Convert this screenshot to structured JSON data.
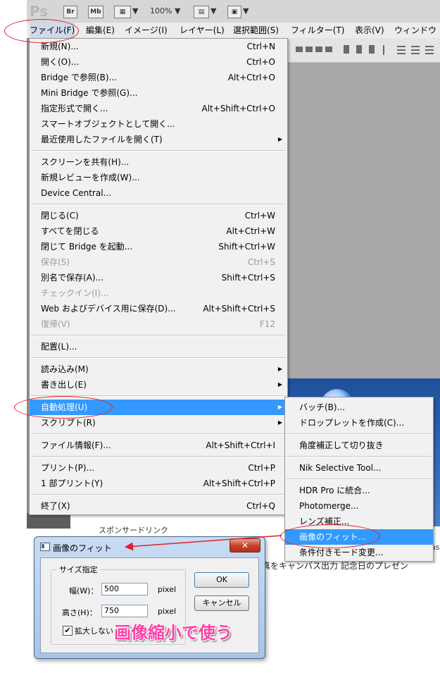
{
  "app": {
    "logo": "Ps",
    "toolbar": {
      "br": "Br",
      "mb": "Mb",
      "zoom": "100%"
    },
    "menubar": [
      "ファイル(F)",
      "編集(E)",
      "イメージ(I)",
      "レイヤー(L)",
      "選択範囲(S)",
      "フィルター(T)",
      "表示(V)",
      "ウィンドウ"
    ]
  },
  "file_menu": {
    "items": [
      {
        "label": "新規(N)...",
        "shortcut": "Ctrl+N"
      },
      {
        "label": "開く(O)...",
        "shortcut": "Ctrl+O"
      },
      {
        "label": "Bridge で参照(B)...",
        "shortcut": "Alt+Ctrl+O"
      },
      {
        "label": "Mini Bridge で参照(G)...",
        "shortcut": ""
      },
      {
        "label": "指定形式で開く...",
        "shortcut": "Alt+Shift+Ctrl+O"
      },
      {
        "label": "スマートオブジェクトとして開く...",
        "shortcut": ""
      },
      {
        "label": "最近使用したファイルを開く(T)",
        "shortcut": "",
        "submenu": true
      },
      {
        "label": "スクリーンを共有(H)...",
        "shortcut": ""
      },
      {
        "label": "新規レビューを作成(W)...",
        "shortcut": ""
      },
      {
        "label": "Device Central...",
        "shortcut": ""
      },
      {
        "label": "閉じる(C)",
        "shortcut": "Ctrl+W"
      },
      {
        "label": "すべてを閉じる",
        "shortcut": "Alt+Ctrl+W"
      },
      {
        "label": "閉じて Bridge を起動...",
        "shortcut": "Shift+Ctrl+W"
      },
      {
        "label": "保存(S)",
        "shortcut": "Ctrl+S",
        "disabled": true
      },
      {
        "label": "別名で保存(A)...",
        "shortcut": "Shift+Ctrl+S"
      },
      {
        "label": "チェックイン(I)...",
        "shortcut": "",
        "disabled": true
      },
      {
        "label": "Web およびデバイス用に保存(D)...",
        "shortcut": "Alt+Shift+Ctrl+S"
      },
      {
        "label": "復帰(V)",
        "shortcut": "F12",
        "disabled": true
      },
      {
        "label": "配置(L)...",
        "shortcut": ""
      },
      {
        "label": "読み込み(M)",
        "shortcut": "",
        "submenu": true
      },
      {
        "label": "書き出し(E)",
        "shortcut": "",
        "submenu": true
      },
      {
        "label": "自動処理(U)",
        "shortcut": "",
        "submenu": true,
        "highlighted": true
      },
      {
        "label": "スクリプト(R)",
        "shortcut": "",
        "submenu": true
      },
      {
        "label": "ファイル情報(F)...",
        "shortcut": "Alt+Shift+Ctrl+I"
      },
      {
        "label": "プリント(P)...",
        "shortcut": "Ctrl+P"
      },
      {
        "label": "1 部プリント(Y)",
        "shortcut": "Alt+Shift+Ctrl+P"
      },
      {
        "label": "終了(X)",
        "shortcut": "Ctrl+Q"
      }
    ]
  },
  "automate_submenu": {
    "items": [
      {
        "label": "バッチ(B)..."
      },
      {
        "label": "ドロップレットを作成(C)..."
      },
      {
        "label": "角度補正して切り抜き"
      },
      {
        "label": "Nik Selective Tool..."
      },
      {
        "label": "HDR Pro に統合..."
      },
      {
        "label": "Photomerge..."
      },
      {
        "label": "レンズ補正..."
      },
      {
        "label": "画像のフィット...",
        "highlighted": true
      },
      {
        "label": "条件付きモード変更..."
      }
    ]
  },
  "page_text": {
    "behind1": "スポンサードリンク",
    "behind2": "真をキャンバス出力 記念日のプレゼン",
    "behind3": "as"
  },
  "dialog": {
    "title": "画像のフィット",
    "close": "✕",
    "group_label": "サイズ指定",
    "width_label": "幅(W)：",
    "width_value": "500",
    "width_unit": "pixel",
    "height_label": "高さ(H)：",
    "height_value": "750",
    "height_unit": "pixel",
    "no_enlarge_label": "拡大しない",
    "no_enlarge_checked": "✔",
    "ok": "OK",
    "cancel": "キャンセル"
  },
  "annotation": {
    "text": "画像縮小で使う",
    "color": "#ff3fa7",
    "ring_color": "#e0202a"
  }
}
